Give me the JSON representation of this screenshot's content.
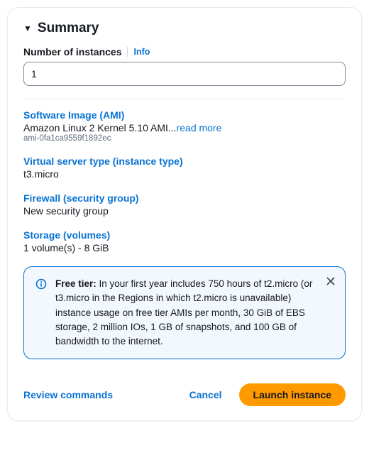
{
  "header": {
    "title": "Summary"
  },
  "numInstances": {
    "label": "Number of instances",
    "info": "Info",
    "value": "1"
  },
  "ami": {
    "title": "Software Image (AMI)",
    "desc": "Amazon Linux 2 Kernel 5.10 AMI...",
    "readMore": "read more",
    "id": "ami-0fa1ca9559f1892ec"
  },
  "instanceType": {
    "title": "Virtual server type (instance type)",
    "value": "t3.micro"
  },
  "firewall": {
    "title": "Firewall (security group)",
    "value": "New security group"
  },
  "storage": {
    "title": "Storage (volumes)",
    "value": "1 volume(s) - 8 GiB"
  },
  "freeTier": {
    "label": "Free tier:",
    "body": " In your first year includes 750 hours of t2.micro (or t3.micro in the Regions in which t2.micro is unavailable) instance usage on free tier AMIs per month, 30 GiB of EBS storage, 2 million IOs, 1 GB of snapshots, and 100 GB of bandwidth to the internet."
  },
  "footer": {
    "review": "Review commands",
    "cancel": "Cancel",
    "launch": "Launch instance"
  }
}
